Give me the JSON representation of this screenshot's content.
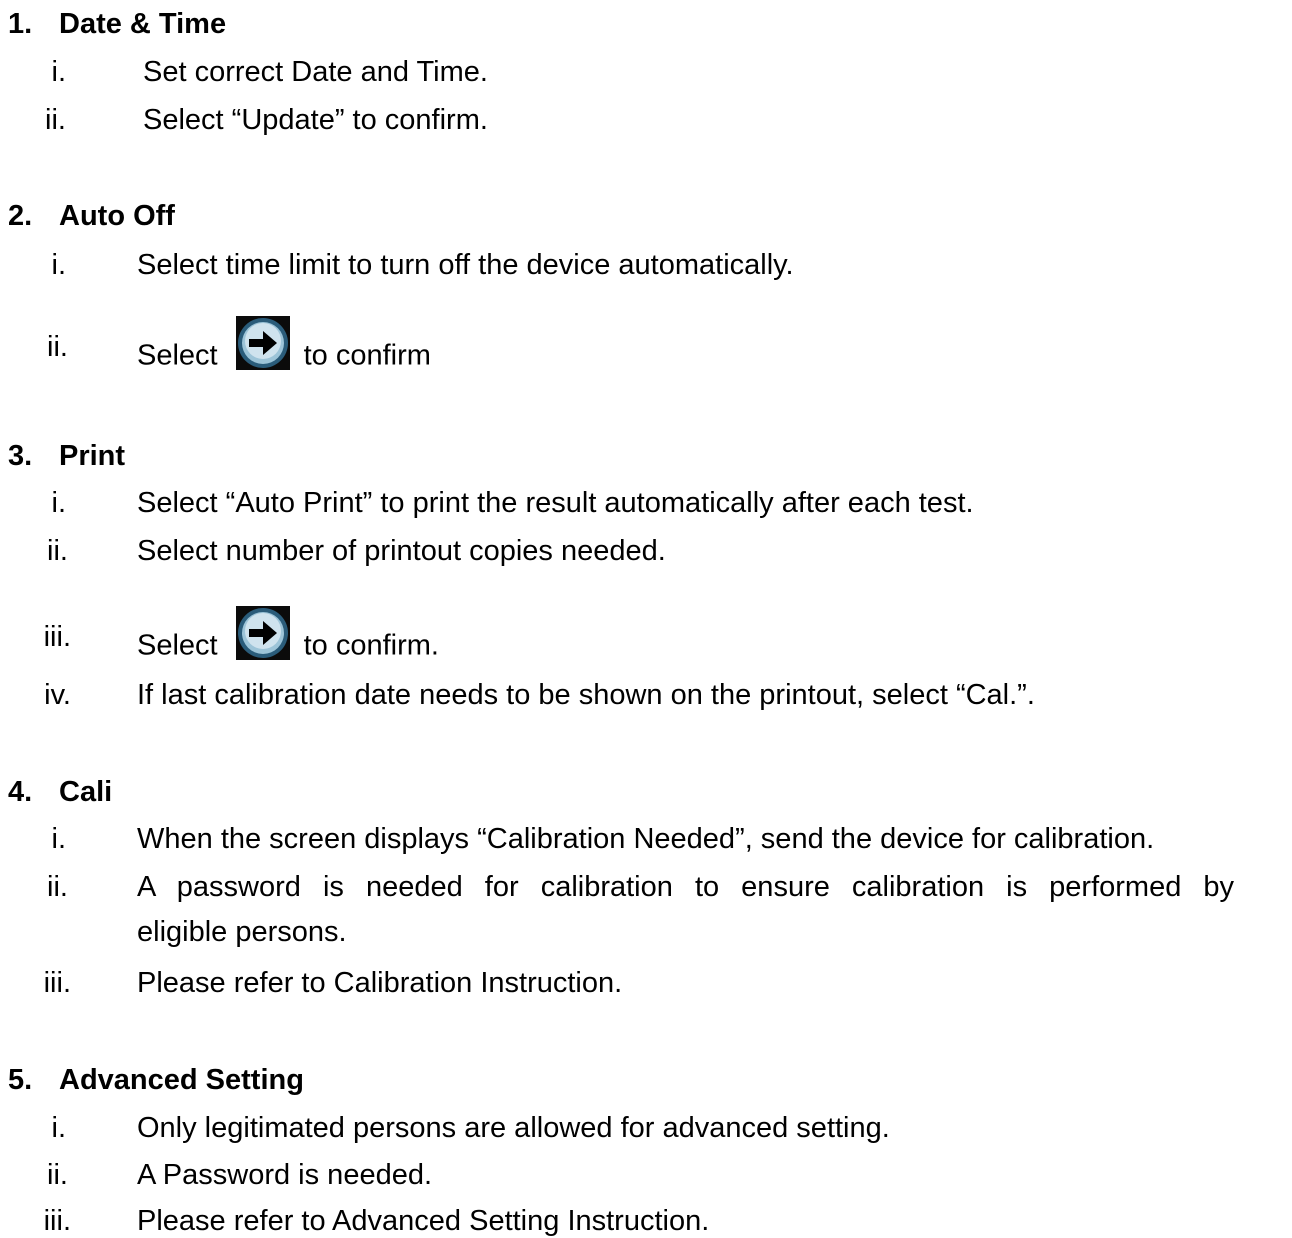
{
  "sections": [
    {
      "number": "1.",
      "title": "Date & Time",
      "items": [
        {
          "marker": "i.",
          "text": "Set correct Date and Time."
        },
        {
          "marker": "ii.",
          "text": "Select “Update” to confirm."
        }
      ]
    },
    {
      "number": "2.",
      "title": "Auto Off",
      "items": [
        {
          "marker": "i.",
          "text": "Select time limit to turn off the device automatically."
        },
        {
          "marker": "ii.",
          "text_before": "Select",
          "icon": "arrow-right-icon",
          "text_after": "to confirm"
        }
      ]
    },
    {
      "number": "3.",
      "title": "Print",
      "items": [
        {
          "marker": "i.",
          "text": "Select “Auto Print” to print the result automatically after each test."
        },
        {
          "marker": "ii.",
          "text": "Select number of printout copies needed."
        },
        {
          "marker": "iii.",
          "text_before": "Select",
          "icon": "arrow-right-icon",
          "text_after": "to confirm."
        },
        {
          "marker": "iv.",
          "text": "If last calibration date needs to be shown on the printout, select “Cal.”."
        }
      ]
    },
    {
      "number": "4.",
      "title": "Cali",
      "items": [
        {
          "marker": "i.",
          "text": "When the screen displays “Calibration Needed”, send the device for calibration."
        },
        {
          "marker": "ii.",
          "text": "A password is needed for calibration to ensure calibration is performed by",
          "text_cont": "eligible persons."
        },
        {
          "marker": "iii.",
          "text": "Please refer to Calibration Instruction."
        }
      ]
    },
    {
      "number": "5.",
      "title": "Advanced Setting",
      "items": [
        {
          "marker": "i.",
          "text": "Only legitimated persons are allowed for advanced setting."
        },
        {
          "marker": "ii.",
          "text": "A Password is needed."
        },
        {
          "marker": "iii.",
          "text": "Please refer to Advanced Setting Instruction."
        }
      ]
    }
  ],
  "colors": {
    "text": "#000000",
    "background": "#ffffff",
    "icon_ring": "#2a5c7a",
    "icon_face": "#cfe3ee",
    "icon_arrow": "#000000"
  }
}
